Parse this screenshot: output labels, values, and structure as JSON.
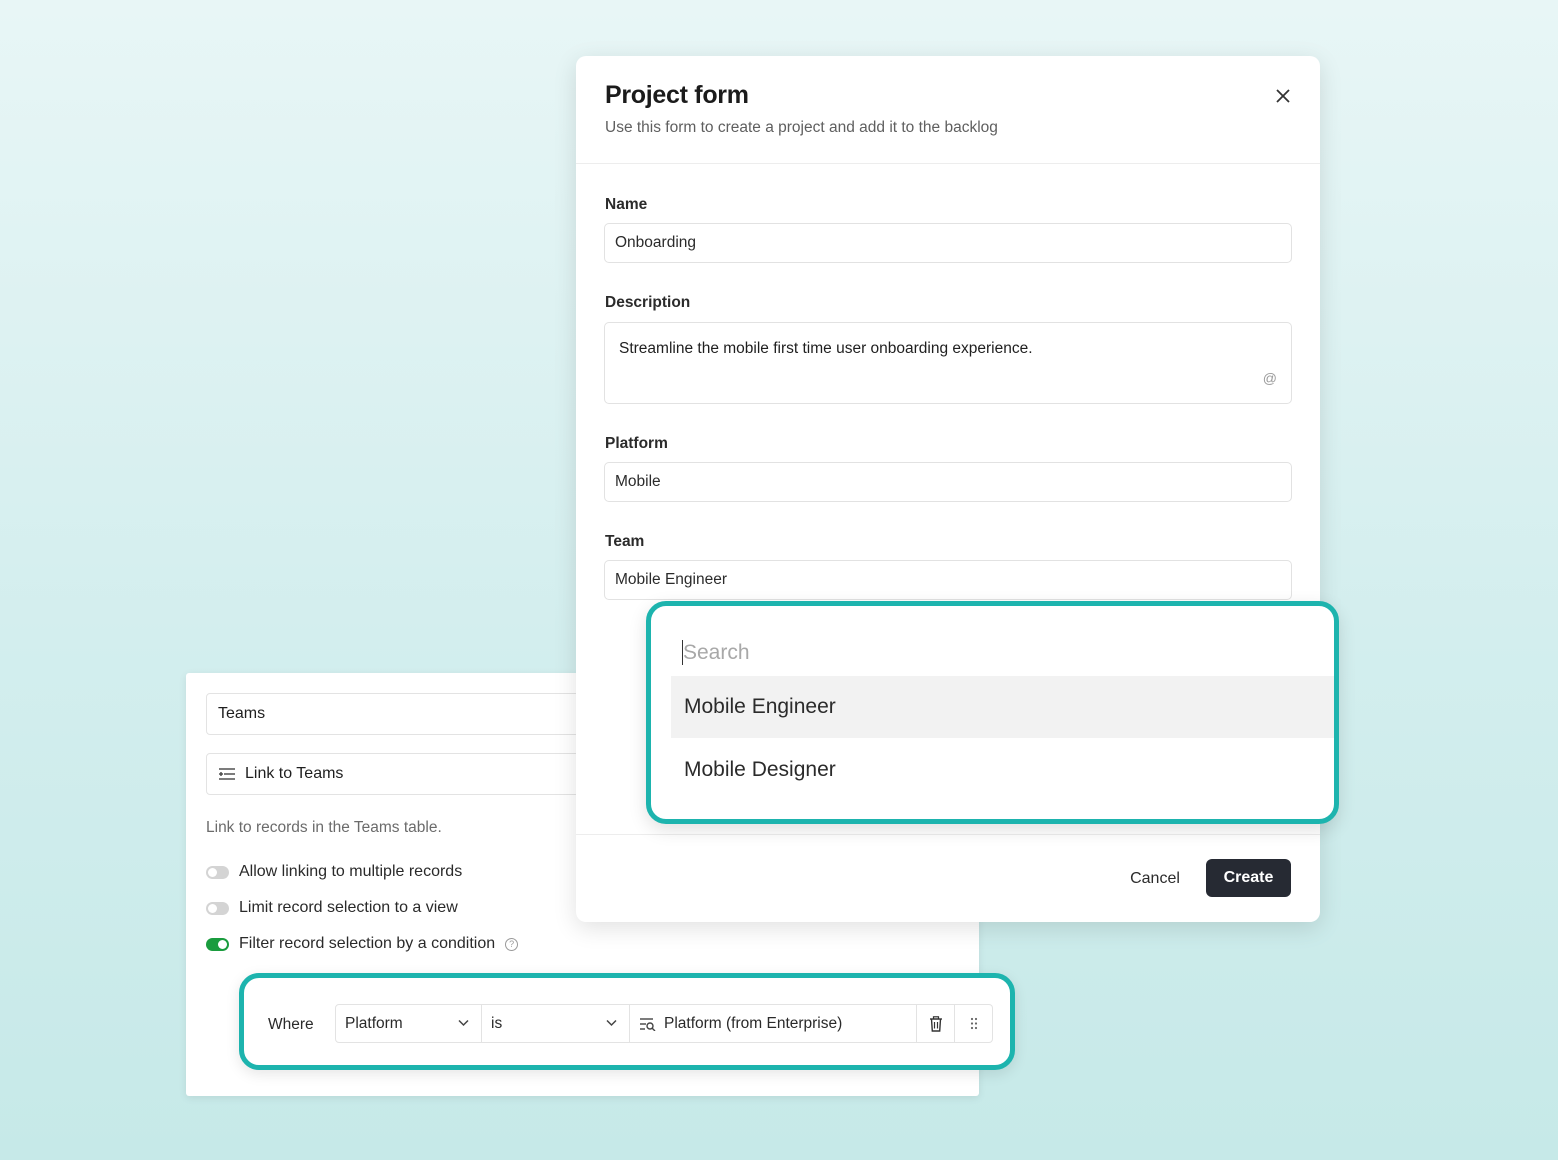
{
  "field_config": {
    "field_name": "Teams",
    "field_type_label": "Link to Teams",
    "description": "Link to records in the Teams table.",
    "toggles": [
      {
        "label": "Allow linking to multiple records",
        "on": false
      },
      {
        "label": "Limit record selection to a view",
        "on": false
      },
      {
        "label": "Filter record selection by a condition",
        "on": true
      }
    ],
    "condition": {
      "where_label": "Where",
      "field": "Platform",
      "operator": "is",
      "value": "Platform (from Enterprise)"
    }
  },
  "dialog": {
    "title": "Project form",
    "subtitle": "Use this form to create a project and add it to the backlog",
    "fields": {
      "name": {
        "label": "Name",
        "value": "Onboarding"
      },
      "description": {
        "label": "Description",
        "value": "Streamline the mobile first time user onboarding experience."
      },
      "platform": {
        "label": "Platform",
        "value": "Mobile"
      },
      "team": {
        "label": "Team",
        "value": "Mobile Engineer"
      }
    },
    "cancel_label": "Cancel",
    "create_label": "Create"
  },
  "dropdown": {
    "search_placeholder": "Search",
    "options": [
      "Mobile Engineer",
      "Mobile Designer"
    ]
  },
  "colors": {
    "highlight": "#1db4ae",
    "toggle_on": "#1a9c3e",
    "primary_button": "#262a33"
  }
}
